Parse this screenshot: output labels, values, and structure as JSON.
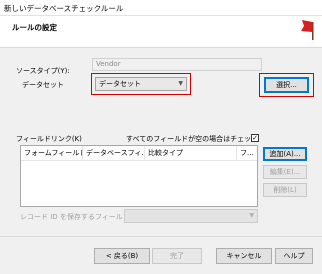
{
  "window": {
    "title": "新しいデータベースチェックルール"
  },
  "header": {
    "title": "ルールの設定"
  },
  "source_type": {
    "label": "ソースタイプ(Y):",
    "value": "Vendor"
  },
  "dataset": {
    "label": "データセット",
    "value": "データセット",
    "select_button": "選択..."
  },
  "field_links": {
    "label": "フィールドリンク(K)",
    "check_label": "すべてのフィールドが空の場合はチェックしない",
    "checked": "✓",
    "columns": [
      "フォームフィールド",
      "データベースフィ...",
      "比較タイプ",
      "フ..."
    ]
  },
  "list_buttons": {
    "add": "追加(A)...",
    "edit": "編集(E)...",
    "delete": "削除(L)"
  },
  "record_id": {
    "label": "レコード ID を保存するフィールド"
  },
  "footer": {
    "back": "< 戻る(B)",
    "finish": "完了",
    "cancel": "キャンセル",
    "help": "ヘルプ"
  },
  "colors": {
    "accent": "#0078d7",
    "highlight": "#d40000",
    "flag": "#d62020"
  }
}
